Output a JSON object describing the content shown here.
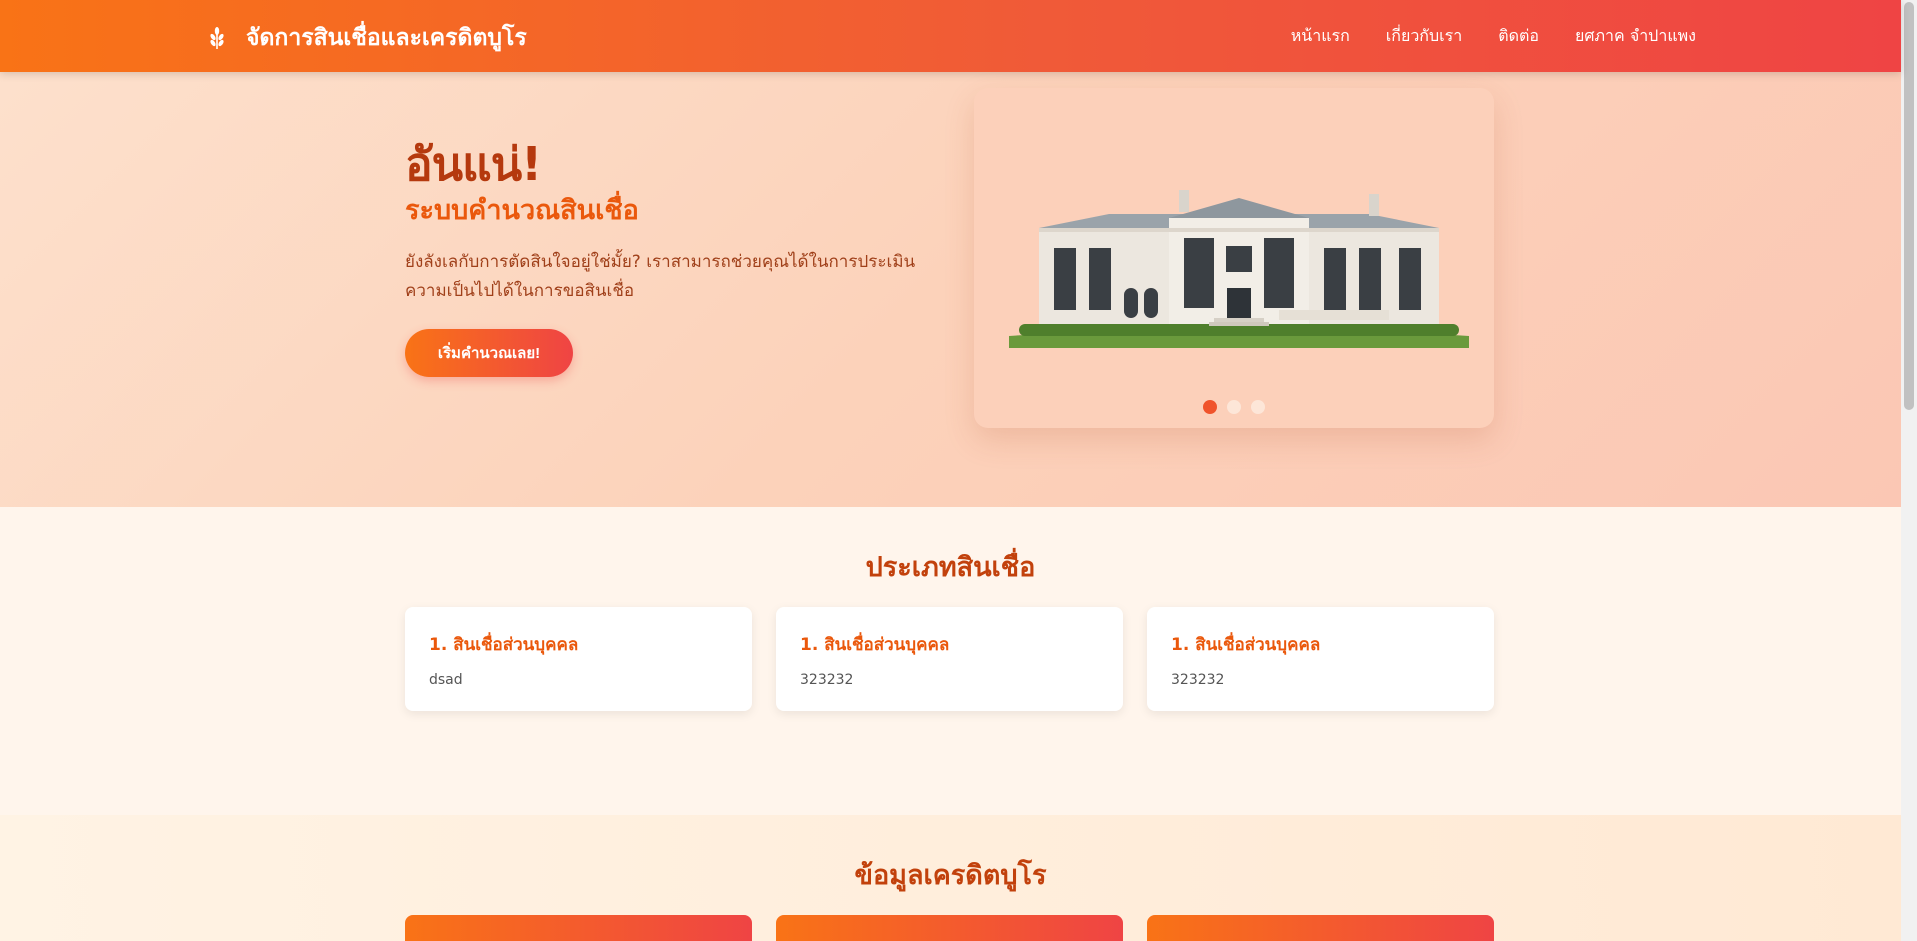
{
  "navbar": {
    "brand_icon": "wheat-icon",
    "title": "จัดการสินเชื่อและเครดิตบูโร",
    "links": [
      "หน้าแรก",
      "เกี่ยวกับเรา",
      "ติดต่อ",
      "ยศภาค จำปาแพง"
    ]
  },
  "hero": {
    "title": "อันแน่!",
    "subtitle": "ระบบคำนวณสินเชื่อ",
    "description": "ยังลังเลกับการตัดสินใจอยู่ใช่มั้ย? เราสามารถช่วยคุณได้ในการประเมินความเป็นไปได้ในการขอสินเชื่อ",
    "button": "เริ่มคำนวณเลย!",
    "carousel": {
      "slides": 3,
      "active_index": 0
    }
  },
  "loans": {
    "title": "ประเภทสินเชื่อ",
    "cards": [
      {
        "title": "1. สินเชื่อส่วนบุคคล",
        "desc": "dsad"
      },
      {
        "title": "1. สินเชื่อส่วนบุคคล",
        "desc": "323232"
      },
      {
        "title": "1. สินเชื่อส่วนบุคคล",
        "desc": "323232"
      }
    ]
  },
  "credit": {
    "title": "ข้อมูลเครดิตบูโร"
  },
  "colors": {
    "primary": "#f97316",
    "accent": "#ef4444",
    "heading": "#c2410c"
  }
}
